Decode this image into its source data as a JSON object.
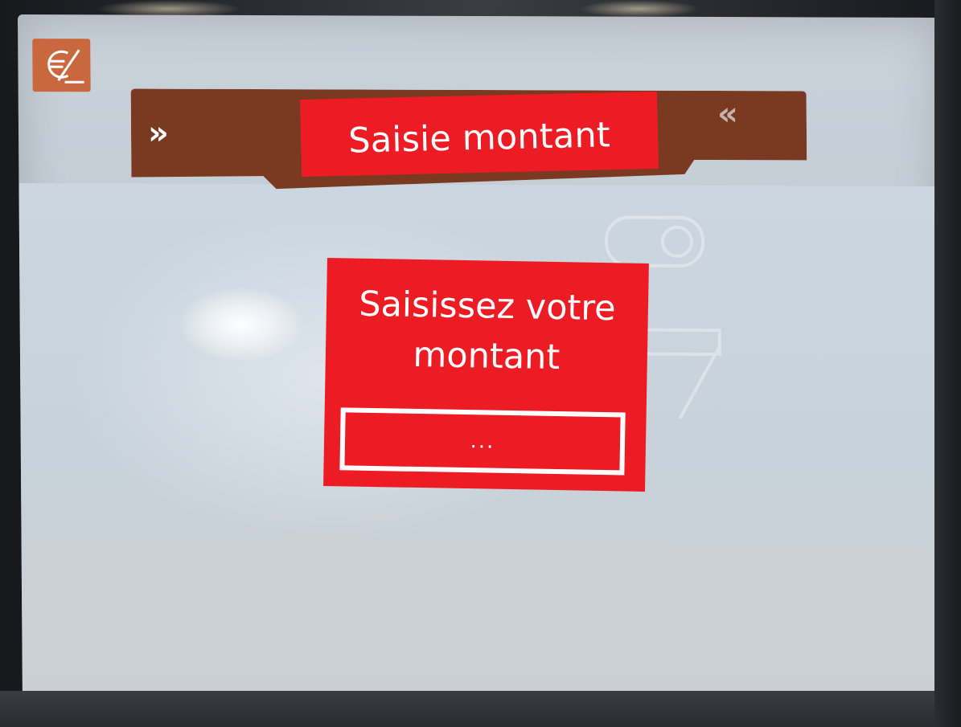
{
  "header": {
    "title": "Saisie montant",
    "nav_left_glyph": "»",
    "nav_right_glyph": "«"
  },
  "prompt": {
    "line1": "Saisissez votre",
    "line2": "montant"
  },
  "amount_input": {
    "value": "..."
  },
  "logo": {
    "icon": "euro-cash-icon"
  },
  "colors": {
    "overlay_red": "#ed1c24",
    "header_brown": "#7a3a22",
    "logo_orange": "#c9683f",
    "screen_bg": "#c8d2da"
  }
}
